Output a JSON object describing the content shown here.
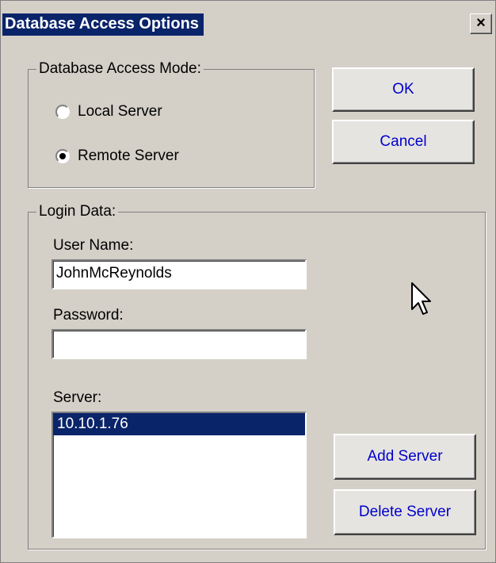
{
  "window": {
    "title": "Database Access Options",
    "close_glyph": "×"
  },
  "access_mode": {
    "legend": "Database Access Mode:",
    "options": [
      {
        "label": "Local Server",
        "checked": false
      },
      {
        "label": "Remote Server",
        "checked": true
      }
    ]
  },
  "buttons": {
    "ok": "OK",
    "cancel": "Cancel",
    "add_server": "Add Server",
    "delete_server": "Delete Server"
  },
  "login": {
    "legend": "Login Data:",
    "user_name_label": "User Name:",
    "user_name_value": "JohnMcReynolds",
    "password_label": "Password:",
    "password_value": "",
    "server_label": "Server:",
    "servers": [
      {
        "value": "10.10.1.76",
        "selected": true
      }
    ]
  },
  "colors": {
    "face": "#d4d0c8",
    "selection": "#0a246a",
    "button_text": "#0000cc"
  },
  "icons": {
    "cursor": "mouse-pointer-icon",
    "close": "close-icon"
  }
}
